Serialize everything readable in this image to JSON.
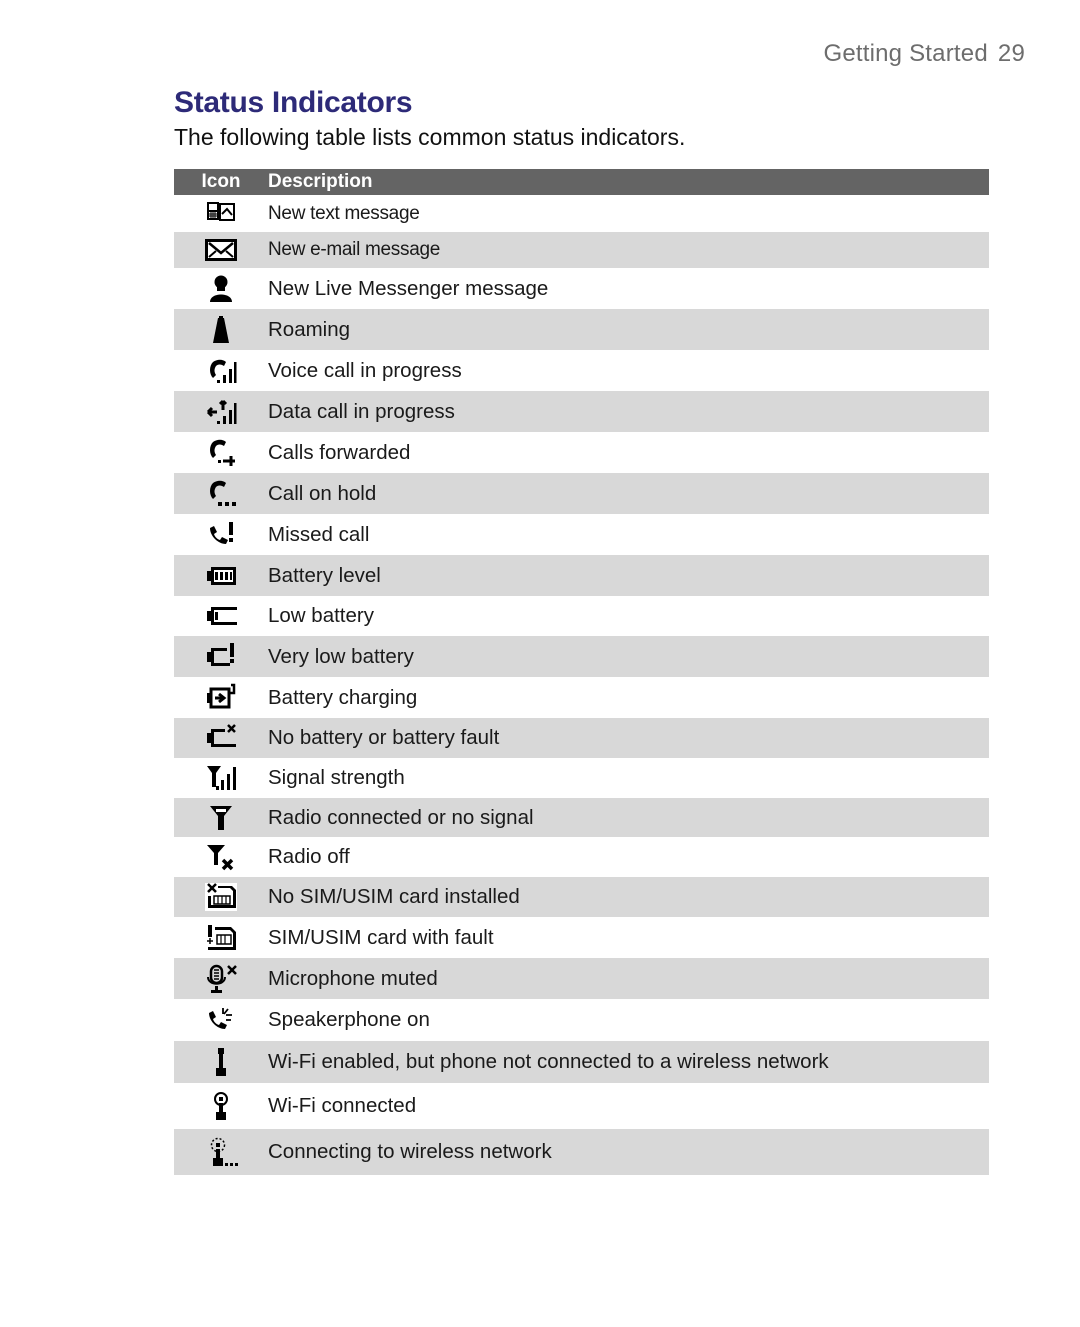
{
  "header": {
    "section": "Getting Started",
    "page_number": "29"
  },
  "title": "Status Indicators",
  "intro": "The following table lists common status indicators.",
  "table": {
    "columns": [
      "Icon",
      "Description"
    ],
    "rows": [
      {
        "icon": "new-text-message-icon",
        "description": "New text message"
      },
      {
        "icon": "new-email-icon",
        "description": "New e-mail message"
      },
      {
        "icon": "live-messenger-icon",
        "description": "New Live Messenger message"
      },
      {
        "icon": "roaming-icon",
        "description": "Roaming"
      },
      {
        "icon": "voice-call-icon",
        "description": "Voice call in progress"
      },
      {
        "icon": "data-call-icon",
        "description": "Data call in progress"
      },
      {
        "icon": "calls-forwarded-icon",
        "description": "Calls forwarded"
      },
      {
        "icon": "call-on-hold-icon",
        "description": "Call on hold"
      },
      {
        "icon": "missed-call-icon",
        "description": "Missed call"
      },
      {
        "icon": "battery-level-icon",
        "description": "Battery level"
      },
      {
        "icon": "low-battery-icon",
        "description": "Low battery"
      },
      {
        "icon": "very-low-battery-icon",
        "description": "Very low battery"
      },
      {
        "icon": "battery-charging-icon",
        "description": "Battery charging"
      },
      {
        "icon": "no-battery-icon",
        "description": "No battery or battery fault"
      },
      {
        "icon": "signal-strength-icon",
        "description": "Signal strength"
      },
      {
        "icon": "radio-no-signal-icon",
        "description": "Radio connected or no signal"
      },
      {
        "icon": "radio-off-icon",
        "description": "Radio off"
      },
      {
        "icon": "no-sim-icon",
        "description": "No SIM/USIM card installed"
      },
      {
        "icon": "sim-fault-icon",
        "description": "SIM/USIM card with fault"
      },
      {
        "icon": "microphone-muted-icon",
        "description": "Microphone muted"
      },
      {
        "icon": "speakerphone-icon",
        "description": "Speakerphone on"
      },
      {
        "icon": "wifi-enabled-icon",
        "description": "Wi-Fi enabled, but phone not connected to a wireless network"
      },
      {
        "icon": "wifi-connected-icon",
        "description": "Wi-Fi connected"
      },
      {
        "icon": "wifi-connecting-icon",
        "description": "Connecting to wireless network"
      }
    ]
  },
  "colors": {
    "title": "#2d2a78",
    "header_bg": "#646464",
    "row_alt_bg": "#d8d8d8",
    "running_head": "#6d6d6d"
  }
}
